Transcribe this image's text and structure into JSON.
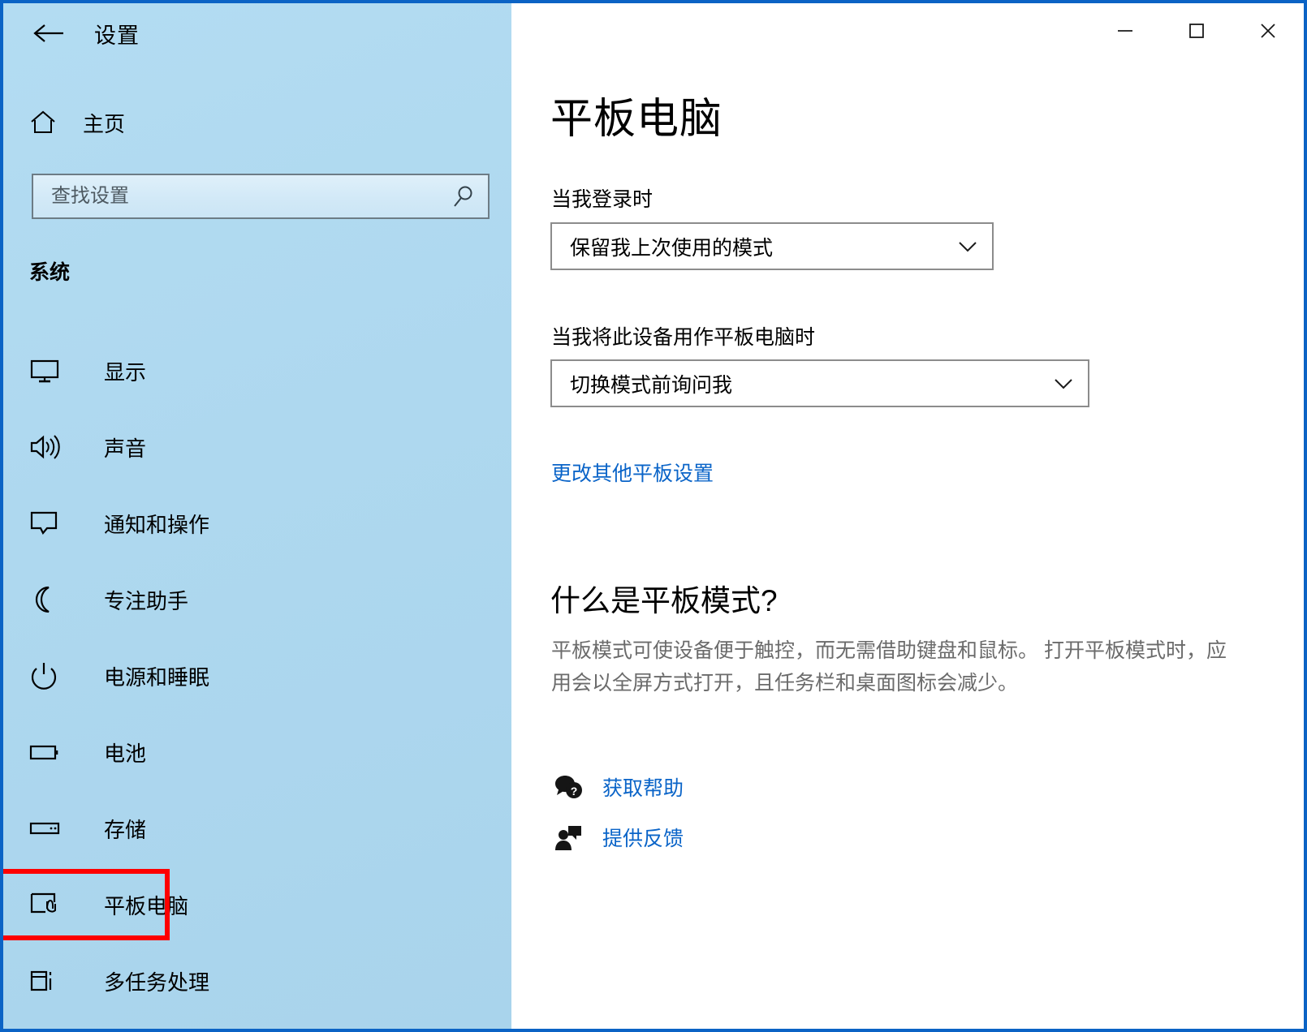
{
  "window": {
    "accent_color": "#0b63c5",
    "sidebar_color": "#aed8ef",
    "link_color": "#0a64c8",
    "highlight_box_color": "#fe0000",
    "controls": {
      "minimize_label": "—",
      "maximize_label": "□",
      "close_label": "✕"
    }
  },
  "sidebar": {
    "back_label": "←",
    "app_title": "设置",
    "home_label": "主页",
    "search": {
      "placeholder": "查找设置",
      "value": ""
    },
    "section_title": "系统",
    "items": [
      {
        "label": "显示",
        "icon": "monitor-icon",
        "selected": false,
        "marked": false
      },
      {
        "label": "声音",
        "icon": "speaker-icon",
        "selected": false,
        "marked": false
      },
      {
        "label": "通知和操作",
        "icon": "notification-icon",
        "selected": false,
        "marked": false
      },
      {
        "label": "专注助手",
        "icon": "moon-icon",
        "selected": false,
        "marked": false
      },
      {
        "label": "电源和睡眠",
        "icon": "power-icon",
        "selected": false,
        "marked": false
      },
      {
        "label": "电池",
        "icon": "battery-icon",
        "selected": false,
        "marked": false
      },
      {
        "label": "存储",
        "icon": "storage-icon",
        "selected": false,
        "marked": false
      },
      {
        "label": "平板电脑",
        "icon": "tablet-icon",
        "selected": true,
        "marked": true
      },
      {
        "label": "多任务处理",
        "icon": "multitask-icon",
        "selected": false,
        "marked": false
      }
    ]
  },
  "main": {
    "page_title": "平板电脑",
    "login_label": "当我登录时",
    "login_value": "保留我上次使用的模式",
    "use_tablet_label": "当我将此设备用作平板电脑时",
    "use_tablet_value": "切换模式前询问我",
    "other_settings_link": "更改其他平板设置",
    "what_is_title": "什么是平板模式?",
    "what_is_body": "平板模式可使设备便于触控，而无需借助键盘和鼠标。 打开平板模式时，应用会以全屏方式打开，且任务栏和桌面图标会减少。",
    "get_help_label": "获取帮助",
    "feedback_label": "提供反馈"
  }
}
